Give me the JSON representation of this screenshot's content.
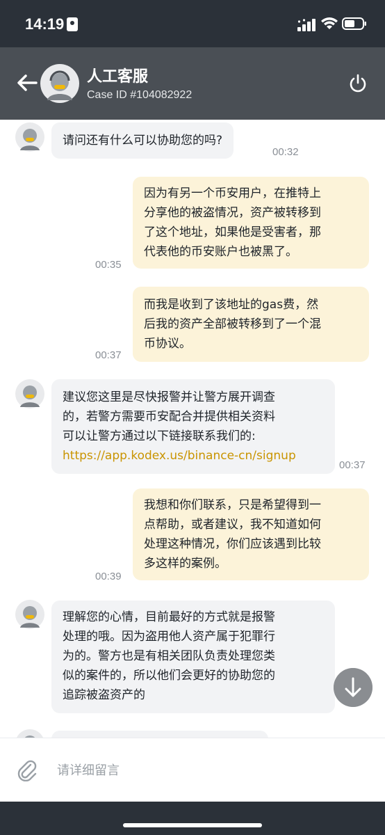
{
  "status_bar": {
    "time": "14:19"
  },
  "header": {
    "title": "人工客服",
    "case_id": "Case ID #104082922",
    "back_icon": "arrow-left-icon",
    "power_icon": "power-icon"
  },
  "messages": [
    {
      "side": "in",
      "lines": [
        "请问还有什么可以协助您的吗?"
      ],
      "time": "00:32"
    },
    {
      "side": "out",
      "lines": [
        "因为有另一个币安用户，在推特上",
        "分享他的被盗情况，资产被转移到",
        "了这个地址，如果他是受害者，那",
        "代表他的币安账户也被黑了。"
      ],
      "time": "00:35"
    },
    {
      "side": "out",
      "lines": [
        "而我是收到了该地址的gas费，然",
        "后我的资产全部被转移到了一个混",
        "币协议。"
      ],
      "time": "00:37"
    },
    {
      "side": "in",
      "lines": [
        "建议您这里是尽快报警并让警方展开调查",
        "的，若警方需要币安配合并提供相关资料",
        "可以让警方通过以下链接联系我们的:"
      ],
      "link": "https://app.kodex.us/binance-cn/signup",
      "time": "00:37"
    },
    {
      "side": "out",
      "lines": [
        "我想和你们联系，只是希望得到一",
        "点帮助，或者建议，我不知道如何",
        "处理这种情况，你们应该遇到比较",
        "多这样的案例。"
      ],
      "time": "00:39"
    },
    {
      "side": "in",
      "lines": [
        "理解您的心情，目前最好的方式就是报警",
        "处理的哦。因为盗用他人资产属于犯罪行",
        "为的。警方也是有相关团队负责处理您类",
        "似的案件的，所以他们会更好的协助您的",
        "追踪被盗资产的"
      ],
      "time": ""
    }
  ],
  "input": {
    "placeholder": "请详细留言",
    "value": ""
  },
  "colors": {
    "status_bar_bg": "#2b3139",
    "header_bg": "#4a4f55",
    "incoming_bubble": "#f2f3f5",
    "outgoing_bubble": "#fcf3d9",
    "link": "#c99400"
  }
}
